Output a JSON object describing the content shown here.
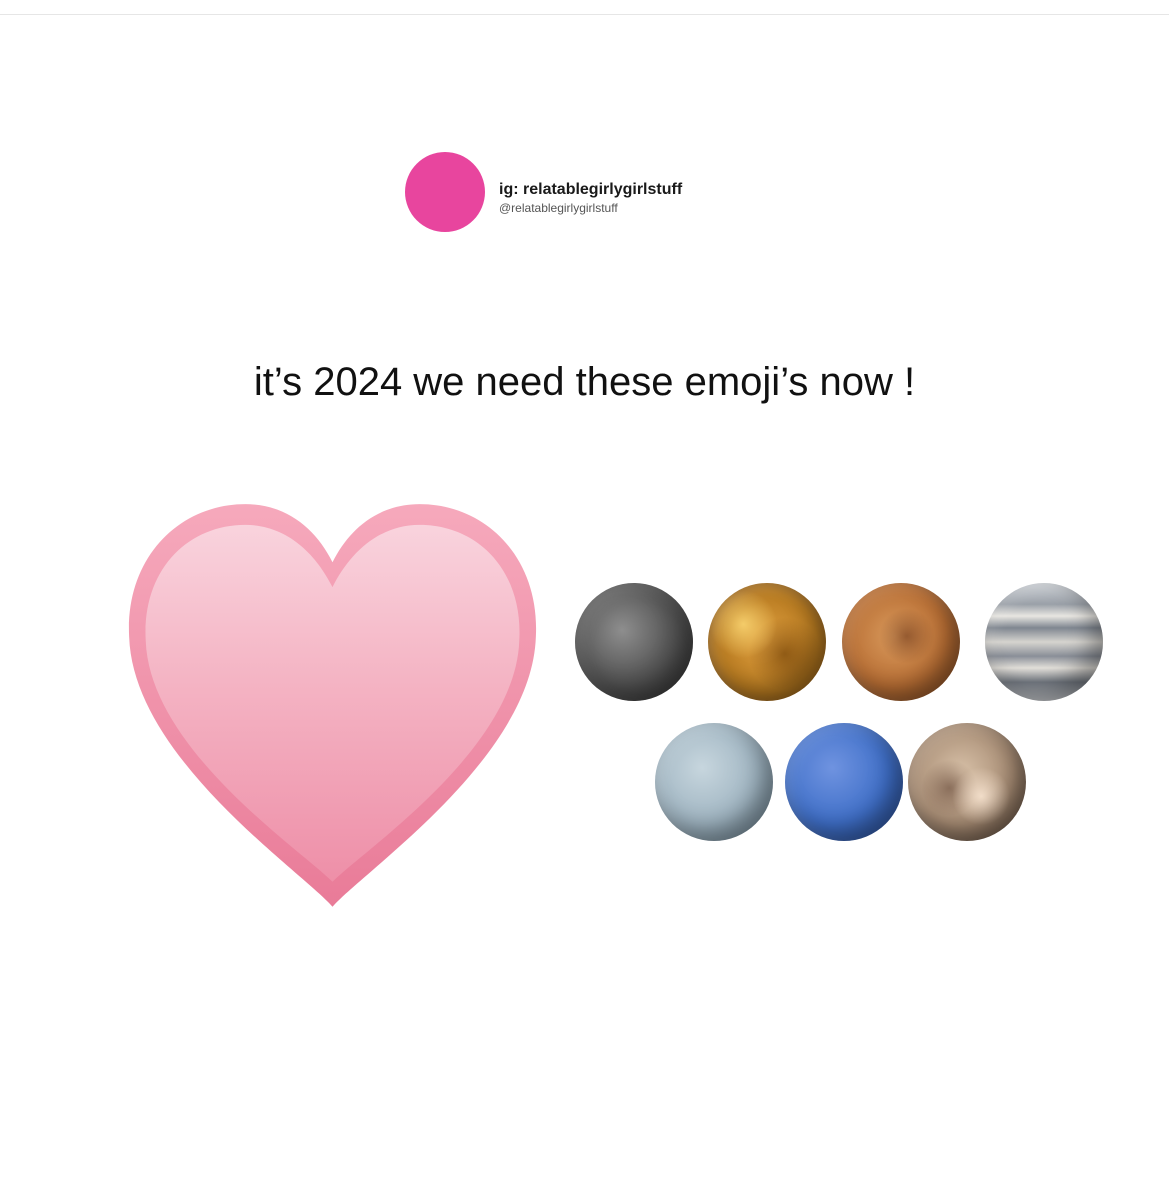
{
  "post": {
    "handle_name": "ig: relatablegirlygirlstuff",
    "handle_sub": "@relatablegirlygirlstuff",
    "avatar_color": "#E8459E",
    "headline": "it’s 2024 we need these emoji’s now !"
  },
  "emojis": {
    "heart": {
      "icon": "pink-heart-icon",
      "color": "#F2A6B9"
    },
    "planets": [
      {
        "icon": "mercury-icon"
      },
      {
        "icon": "venus-icon"
      },
      {
        "icon": "mars-icon"
      },
      {
        "icon": "jupiter-icon"
      },
      {
        "icon": "uranus-icon"
      },
      {
        "icon": "neptune-icon"
      },
      {
        "icon": "pluto-icon"
      }
    ]
  }
}
